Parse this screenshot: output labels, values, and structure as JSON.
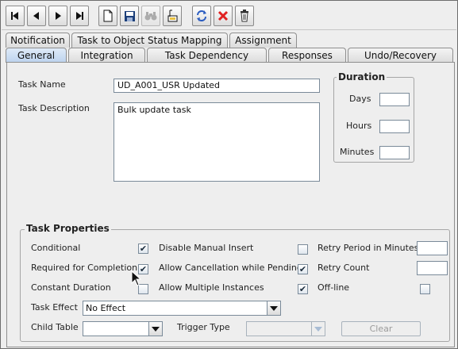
{
  "toolbar": {
    "buttons": [
      {
        "icon": "first-record-icon"
      },
      {
        "icon": "previous-record-icon"
      },
      {
        "icon": "next-record-icon"
      },
      {
        "icon": "last-record-icon"
      },
      {
        "icon": "new-document-icon"
      },
      {
        "icon": "save-icon"
      },
      {
        "icon": "find-binoculars-icon"
      },
      {
        "icon": "query-icon"
      },
      {
        "icon": "refresh-icon"
      },
      {
        "icon": "delete-x-icon"
      },
      {
        "icon": "trash-icon"
      }
    ]
  },
  "tabs_row1": [
    "Notification",
    "Task to Object Status Mapping",
    "Assignment"
  ],
  "tabs_row2": [
    "General",
    "Integration",
    "Task Dependency",
    "Responses",
    "Undo/Recovery"
  ],
  "selected_tab": "General",
  "form": {
    "task_name_label": "Task Name",
    "task_name_value": "UD_A001_USR Updated",
    "task_description_label": "Task Description",
    "task_description_value": "Bulk update task"
  },
  "duration": {
    "title": "Duration",
    "days_label": "Days",
    "hours_label": "Hours",
    "minutes_label": "Minutes",
    "days_value": "",
    "hours_value": "",
    "minutes_value": ""
  },
  "task_properties": {
    "title": "Task Properties",
    "conditional_label": "Conditional",
    "conditional_checked": true,
    "required_label": "Required for Completion",
    "required_checked": true,
    "constant_duration_label": "Constant Duration",
    "constant_duration_checked": false,
    "disable_manual_insert_label": "Disable Manual Insert",
    "disable_manual_insert_checked": false,
    "allow_cancellation_label": "Allow Cancellation while Pending",
    "allow_cancellation_checked": true,
    "allow_multiple_label": "Allow Multiple Instances",
    "allow_multiple_checked": true,
    "retry_period_label": "Retry Period in Minutes",
    "retry_period_value": "",
    "retry_count_label": "Retry Count",
    "retry_count_value": "",
    "offline_label": "Off-line",
    "offline_checked": false,
    "task_effect_label": "Task Effect",
    "task_effect_value": "No Effect",
    "child_table_label": "Child Table",
    "child_table_value": "",
    "trigger_type_label": "Trigger Type",
    "trigger_type_value": "",
    "clear_button": "Clear"
  },
  "colors": {
    "selected_tab": "#bcd3ee",
    "delete_red": "#e02020",
    "refresh_blue": "#2a5cc0"
  }
}
